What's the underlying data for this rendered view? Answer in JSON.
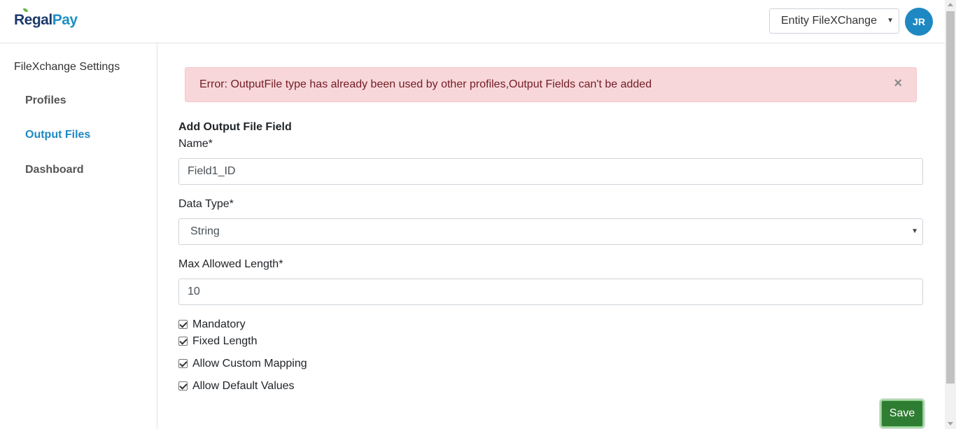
{
  "header": {
    "logo": {
      "part1": "Regal",
      "part2": "Pay"
    },
    "entity_selected": "Entity FileXChange",
    "avatar_initials": "JR"
  },
  "sidebar": {
    "heading": "FileXchange Settings",
    "items": [
      {
        "label": "Profiles",
        "active": false
      },
      {
        "label": "Output Files",
        "active": true
      },
      {
        "label": "Dashboard",
        "active": false
      }
    ]
  },
  "alert": {
    "message": "Error: OutputFile type has already been used by other profiles,Output Fields can't be added",
    "close_symbol": "×"
  },
  "form": {
    "title": "Add Output File Field",
    "name_label": "Name*",
    "name_value": "Field1_ID",
    "data_type_label": "Data Type*",
    "data_type_value": "String",
    "max_length_label": "Max Allowed Length*",
    "max_length_value": "10",
    "checkboxes": [
      {
        "label": "Mandatory",
        "checked": true
      },
      {
        "label": "Fixed Length",
        "checked": true
      },
      {
        "label": "Allow Custom Mapping",
        "checked": true
      },
      {
        "label": "Allow Default Values",
        "checked": true
      }
    ],
    "save_label": "Save"
  },
  "colors": {
    "accent": "#1e88c3",
    "alert_bg": "#f8d7da",
    "alert_text": "#721c24",
    "save_bg": "#2e7d32"
  }
}
